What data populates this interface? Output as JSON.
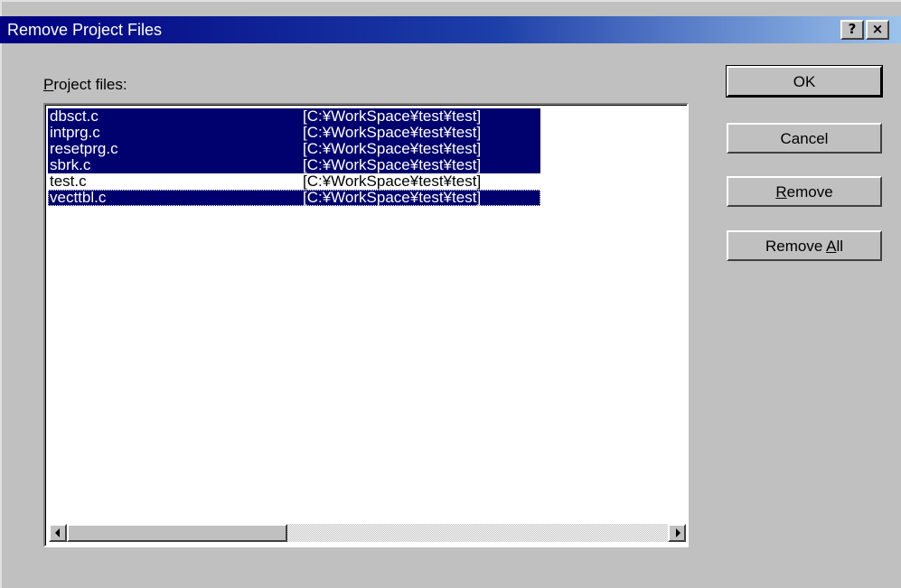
{
  "window": {
    "title": "Remove Project Files",
    "help_button": "?",
    "close_button": "×"
  },
  "list": {
    "label_prefix": "P",
    "label_rest": "roject files:",
    "rows": [
      {
        "name": "dbsct.c",
        "path": "[C:¥WorkSpace¥test¥test]",
        "selected": true
      },
      {
        "name": "intprg.c",
        "path": "[C:¥WorkSpace¥test¥test]",
        "selected": true
      },
      {
        "name": "resetprg.c",
        "path": "[C:¥WorkSpace¥test¥test]",
        "selected": true
      },
      {
        "name": "sbrk.c",
        "path": "[C:¥WorkSpace¥test¥test]",
        "selected": true
      },
      {
        "name": "test.c",
        "path": "[C:¥WorkSpace¥test¥test]",
        "selected": false
      },
      {
        "name": "vecttbl.c",
        "path": "[C:¥WorkSpace¥test¥test]",
        "selected": true,
        "focused": true
      }
    ],
    "scroll_position": 0
  },
  "buttons": {
    "ok": "OK",
    "cancel": "Cancel",
    "remove_mnemonic": "R",
    "remove_rest": "emove",
    "remove_all_prefix": "Remove ",
    "remove_all_mnemonic": "A",
    "remove_all_rest": "ll"
  },
  "colors": {
    "selection": "#00006e",
    "title_start": "#000080",
    "title_end": "#9cc3ec",
    "face": "#c0c0c0"
  }
}
